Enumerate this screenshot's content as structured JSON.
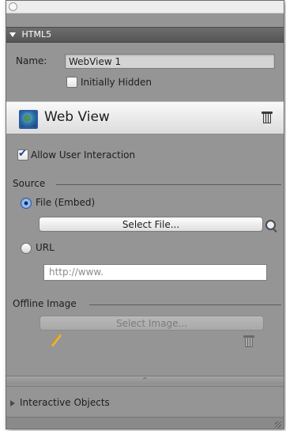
{
  "html5_section": {
    "title": "HTML5"
  },
  "name_field": {
    "label": "Name:",
    "value": "WebView 1"
  },
  "initially_hidden": {
    "label": "Initially Hidden",
    "checked": false
  },
  "web_view": {
    "title": "Web View",
    "icon": "globe-icon"
  },
  "allow_interaction": {
    "label": "Allow User Interaction",
    "checked": true
  },
  "source": {
    "heading": "Source",
    "file_option": {
      "label": "File (Embed)",
      "selected": true
    },
    "select_file_button": "Select File...",
    "url_option": {
      "label": "URL",
      "selected": false
    },
    "url_value": "http://www."
  },
  "offline_image": {
    "heading": "Offline Image",
    "select_button": "Select Image..."
  },
  "interactive_objects": {
    "label": "Interactive Objects"
  },
  "colors": {
    "panel_bg": "#959595",
    "header_bg": "#555555",
    "accent": "#2b5aa6"
  }
}
